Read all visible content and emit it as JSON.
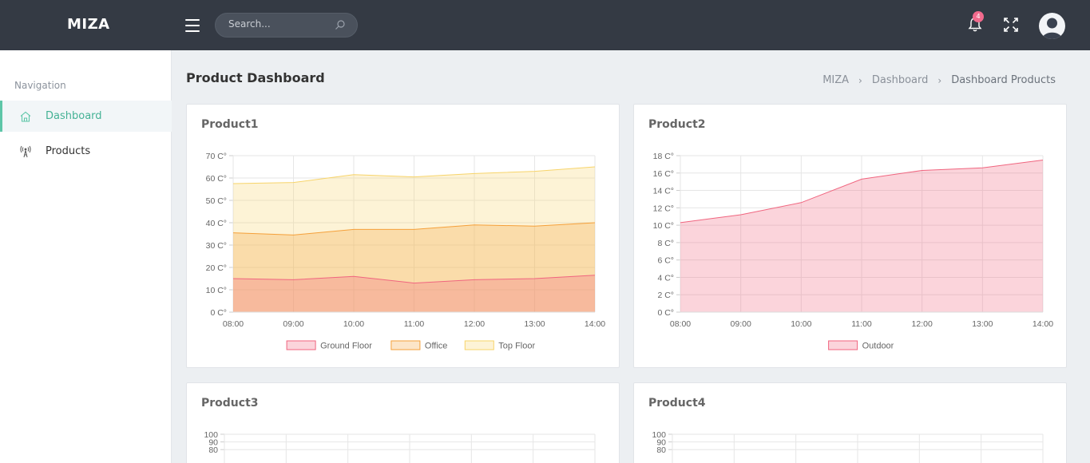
{
  "topbar": {
    "brand": "MIZA",
    "search_placeholder": "Search...",
    "notification_count": "4"
  },
  "sidebar": {
    "heading": "Navigation",
    "items": [
      {
        "label": "Dashboard",
        "icon": "home-icon",
        "active": true
      },
      {
        "label": "Products",
        "icon": "antenna-icon",
        "active": false
      }
    ]
  },
  "page": {
    "title": "Product Dashboard",
    "breadcrumb": [
      "MIZA",
      "Dashboard",
      "Dashboard Products"
    ]
  },
  "cards": [
    {
      "title": "Product1"
    },
    {
      "title": "Product2"
    },
    {
      "title": "Product3"
    },
    {
      "title": "Product4"
    }
  ],
  "colors": {
    "accent": "#5ec6a8",
    "topbar": "#343a44",
    "badge": "#f26a8d",
    "ground_floor": "#f0657f",
    "office": "#f5a03a",
    "top_floor": "#f7d46a",
    "outdoor": "#f0657f"
  },
  "chart_data": [
    {
      "type": "area",
      "x": [
        "08:00",
        "09:00",
        "10:00",
        "11:00",
        "12:00",
        "13:00",
        "14:00"
      ],
      "y_ticks": [
        "0 C°",
        "10 C°",
        "20 C°",
        "30 C°",
        "40 C°",
        "50 C°",
        "60 C°",
        "70 C°"
      ],
      "ylim": [
        0,
        70
      ],
      "stacked": true,
      "series": [
        {
          "name": "Ground Floor",
          "values": [
            15,
            14.5,
            16,
            13,
            14.5,
            15,
            16.5
          ]
        },
        {
          "name": "Office",
          "values": [
            35.5,
            34.5,
            37,
            37,
            39,
            38.5,
            40
          ]
        },
        {
          "name": "Top Floor",
          "values": [
            57.5,
            58,
            61.5,
            60.5,
            62,
            63,
            65
          ]
        }
      ],
      "legend": "bottom",
      "grid": true
    },
    {
      "type": "area",
      "x": [
        "08:00",
        "09:00",
        "10:00",
        "11:00",
        "12:00",
        "13:00",
        "14:00"
      ],
      "y_ticks": [
        "0 C°",
        "2 C°",
        "4 C°",
        "6 C°",
        "8 C°",
        "10 C°",
        "12 C°",
        "14 C°",
        "16 C°",
        "18 C°"
      ],
      "ylim": [
        0,
        18
      ],
      "series": [
        {
          "name": "Outdoor",
          "values": [
            10.3,
            11.2,
            12.6,
            15.3,
            16.3,
            16.6,
            17.5
          ]
        }
      ],
      "legend": "bottom",
      "grid": true
    },
    {
      "type": "line",
      "y_ticks": [
        "100",
        "90",
        "80"
      ],
      "ylim": [
        0,
        100
      ],
      "series": [],
      "grid": true
    },
    {
      "type": "line",
      "y_ticks": [
        "100",
        "90",
        "80"
      ],
      "ylim": [
        0,
        100
      ],
      "series": [],
      "grid": true
    }
  ]
}
